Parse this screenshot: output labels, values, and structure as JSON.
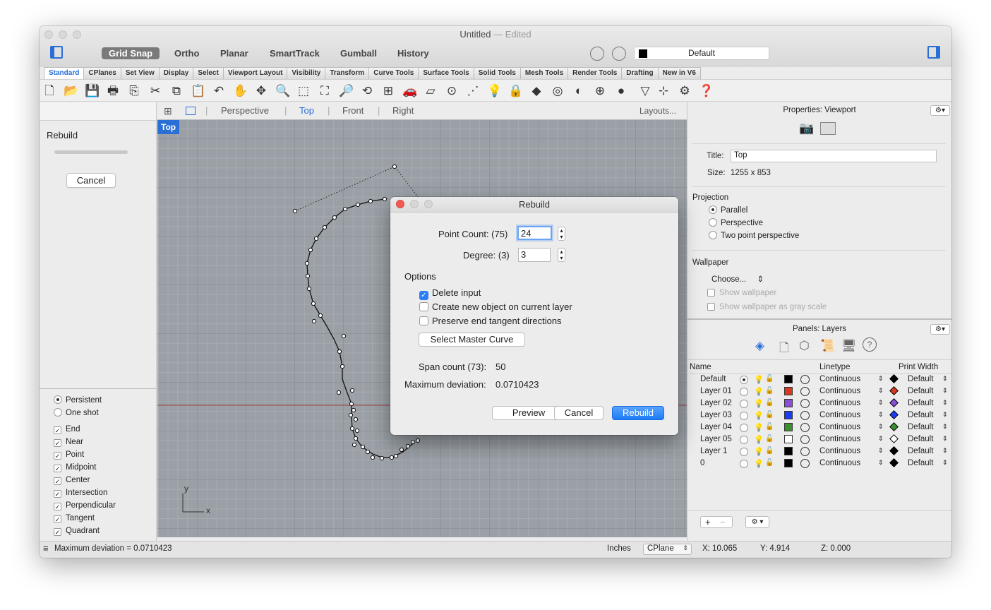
{
  "window": {
    "title": "Untitled",
    "edited": "— Edited"
  },
  "toolbar": {
    "buttons": [
      "Grid Snap",
      "Ortho",
      "Planar",
      "SmartTrack",
      "Gumball",
      "History"
    ],
    "layer": "Default"
  },
  "tabs": [
    "Standard",
    "CPlanes",
    "Set View",
    "Display",
    "Select",
    "Viewport Layout",
    "Visibility",
    "Transform",
    "Curve Tools",
    "Surface Tools",
    "Solid Tools",
    "Mesh Tools",
    "Render Tools",
    "Drafting",
    "New in V6"
  ],
  "left_panel": {
    "title": "Rebuild",
    "cancel": "Cancel",
    "snap_modes": [
      "Persistent",
      "One shot"
    ],
    "osnaps": [
      "End",
      "Near",
      "Point",
      "Midpoint",
      "Center",
      "Intersection",
      "Perpendicular",
      "Tangent",
      "Quadrant"
    ]
  },
  "viewport_tabs": {
    "items": [
      "Perspective",
      "Top",
      "Front",
      "Right"
    ],
    "layouts": "Layouts...",
    "active_label": "Top"
  },
  "axes": {
    "y": "y",
    "x": "x"
  },
  "dialog": {
    "title": "Rebuild",
    "point_count_label": "Point Count: (75)",
    "point_count_value": "24",
    "degree_label": "Degree: (3)",
    "degree_value": "3",
    "options_label": "Options",
    "opt_delete": "Delete input",
    "opt_new_layer": "Create new object on current layer",
    "opt_preserve": "Preserve end tangent directions",
    "select_master": "Select Master Curve",
    "span_count_label": "Span count (73):",
    "span_count_value": "50",
    "max_dev_label": "Maximum deviation:",
    "max_dev_value": "0.0710423",
    "preview": "Preview",
    "cancel": "Cancel",
    "rebuild": "Rebuild"
  },
  "properties": {
    "header": "Properties: Viewport",
    "title_label": "Title:",
    "title_value": "Top",
    "size_label": "Size:",
    "size_value": "1255 x 853",
    "projection_label": "Projection",
    "projections": [
      "Parallel",
      "Perspective",
      "Two point perspective"
    ],
    "wallpaper_label": "Wallpaper",
    "choose": "Choose...",
    "show_wallpaper": "Show wallpaper",
    "show_gray": "Show wallpaper as gray scale"
  },
  "layers": {
    "header": "Panels: Layers",
    "col_name": "Name",
    "col_linetype": "Linetype",
    "col_print_width": "Print Width",
    "rows": [
      {
        "name": "Default",
        "color": "#000000",
        "linetype": "Continuous",
        "width": "Default"
      },
      {
        "name": "Layer 01",
        "color": "#d43a1f",
        "linetype": "Continuous",
        "width": "Default"
      },
      {
        "name": "Layer 02",
        "color": "#8a4fd6",
        "linetype": "Continuous",
        "width": "Default"
      },
      {
        "name": "Layer 03",
        "color": "#1a3ff2",
        "linetype": "Continuous",
        "width": "Default"
      },
      {
        "name": "Layer 04",
        "color": "#3a8f2e",
        "linetype": "Continuous",
        "width": "Default"
      },
      {
        "name": "Layer 05",
        "color": "#ffffff",
        "linetype": "Continuous",
        "width": "Default"
      },
      {
        "name": "Layer 1",
        "color": "#000000",
        "linetype": "Continuous",
        "width": "Default"
      },
      {
        "name": "0",
        "color": "#000000",
        "linetype": "Continuous",
        "width": "Default"
      }
    ]
  },
  "status": {
    "message": "Maximum deviation = 0.0710423",
    "units": "Inches",
    "cplane": "CPlane",
    "x": "X: 10.065",
    "y": "Y: 4.914",
    "z": "Z: 0.000"
  }
}
